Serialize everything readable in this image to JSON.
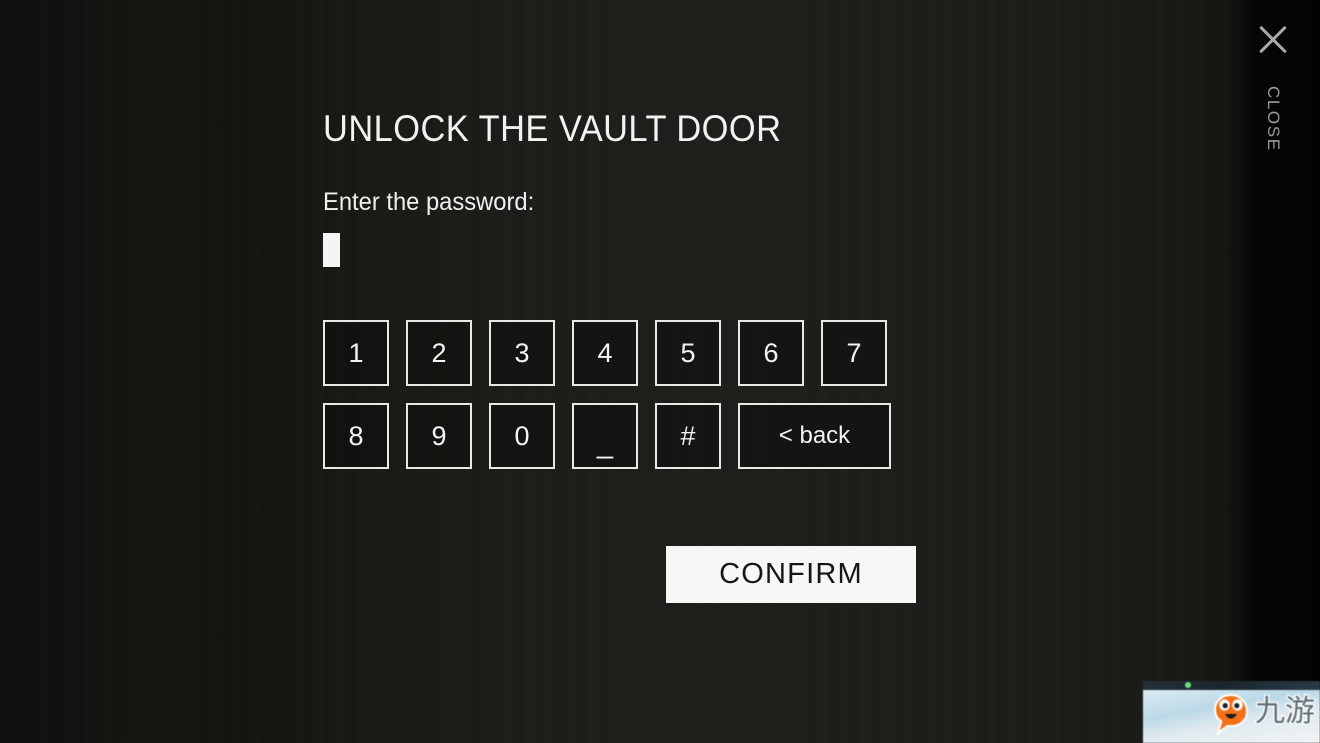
{
  "dialog": {
    "title": "UNLOCK THE VAULT DOOR",
    "prompt": "Enter the password:",
    "password_value": "",
    "confirm_label": "CONFIRM"
  },
  "close": {
    "icon": "close-x-icon",
    "label": "CLOSE",
    "color": "#a8a8a8"
  },
  "keypad": {
    "row1": [
      {
        "label": "1"
      },
      {
        "label": "2"
      },
      {
        "label": "3"
      },
      {
        "label": "4"
      },
      {
        "label": "5"
      },
      {
        "label": "6"
      },
      {
        "label": "7"
      }
    ],
    "row2": [
      {
        "label": "8"
      },
      {
        "label": "9"
      },
      {
        "label": "0"
      },
      {
        "label": "_"
      },
      {
        "label": "#"
      },
      {
        "label": "< back"
      }
    ]
  },
  "watermark": {
    "logo_text": "九游"
  },
  "colors": {
    "background": "#1c1d18",
    "text": "#f2f2f2",
    "key_border": "#e8e8e8",
    "confirm_bg": "#f7f7f7",
    "confirm_text": "#171717",
    "close_grey": "#a8a8a8",
    "mascot_orange": "#f4701a"
  }
}
